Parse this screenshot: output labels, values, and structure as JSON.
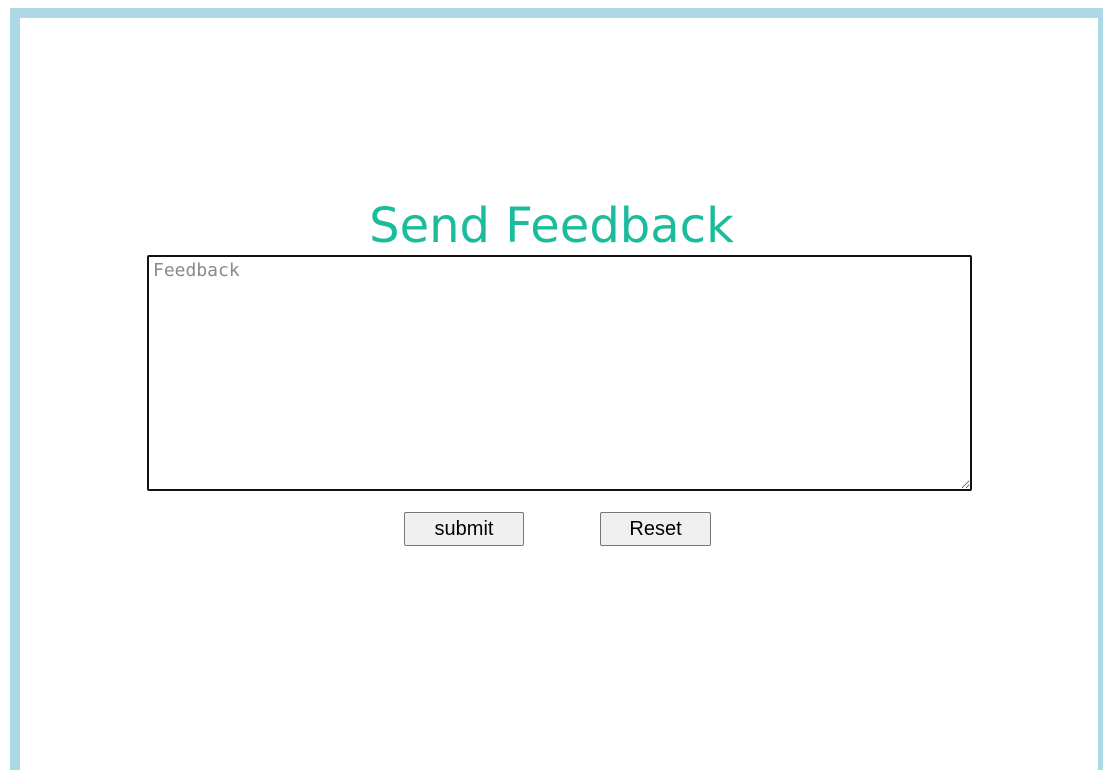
{
  "form": {
    "title": "Send Feedback",
    "feedback_placeholder": "Feedback",
    "feedback_value": "",
    "submit_label": "submit",
    "reset_label": "Reset"
  },
  "colors": {
    "frame_border": "#add8e6",
    "title": "#1abc9c",
    "background": "#ffffff"
  }
}
